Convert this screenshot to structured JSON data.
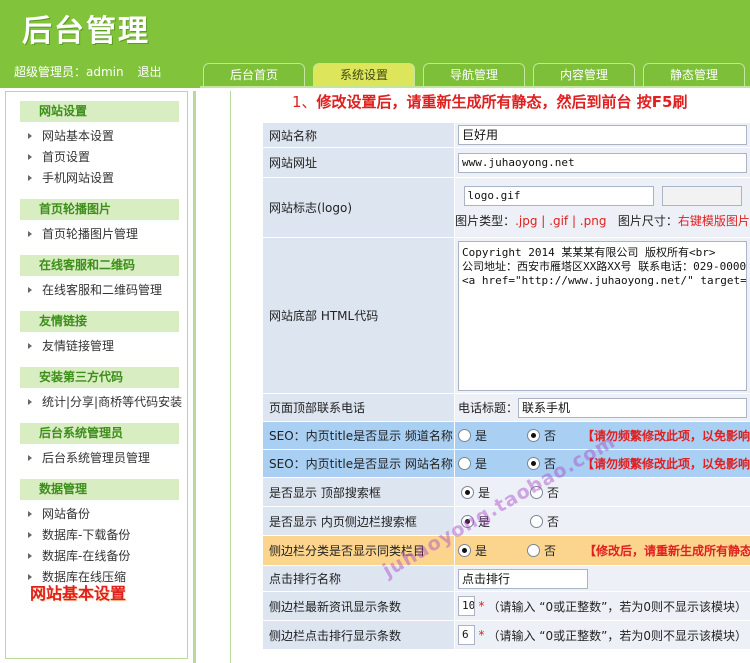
{
  "header": {
    "title": "后台管理",
    "user_label": "超级管理员：admin",
    "logout": "退出"
  },
  "tabs": [
    {
      "label": "后台首页"
    },
    {
      "label": "系统设置"
    },
    {
      "label": "导航管理"
    },
    {
      "label": "内容管理"
    },
    {
      "label": "静态管理"
    }
  ],
  "sidebar": {
    "sections": [
      {
        "title": "网站设置",
        "items": [
          "网站基本设置",
          "首页设置",
          "手机网站设置"
        ]
      },
      {
        "title": "首页轮播图片",
        "items": [
          "首页轮播图片管理"
        ]
      },
      {
        "title": "在线客服和二维码",
        "items": [
          "在线客服和二维码管理"
        ]
      },
      {
        "title": "友情链接",
        "items": [
          "友情链接管理"
        ]
      },
      {
        "title": "安装第三方代码",
        "items": [
          "统计|分享|商桥等代码安装"
        ]
      },
      {
        "title": "后台系统管理员",
        "items": [
          "后台系统管理员管理"
        ]
      },
      {
        "title": "数据管理",
        "items": [
          "网站备份",
          "数据库-下载备份",
          "数据库-在线备份",
          "数据库在线压缩"
        ]
      }
    ],
    "caption": "网站基本设置"
  },
  "notice": {
    "num": "1、",
    "text": "修改设置后，请重新生成所有静态，然后到前台 按F5刷"
  },
  "form": {
    "site_name_label": "网站名称",
    "site_name_value": "巨好用",
    "site_url_label": "网站网址",
    "site_url_value": "www.juhaoyong.net",
    "logo_label": "网站标志(logo)",
    "logo_value": "logo.gif",
    "logo_type_label": "图片类型：",
    "logo_type_value": ".jpg | .gif | .png",
    "logo_size_label": "图片尺寸：",
    "logo_size_value": "右键模版图片",
    "footer_label": "网站底部 HTML代码",
    "footer_value": "Copyright 2014 某某某有限公司 版权所有<br>\n公司地址：西安市雁塔区XX路XX号 联系电话：029-0000\n<a href=\"http://www.juhaoyong.net/\" target=\"_blan",
    "phone_label": "页面顶部联系电话",
    "phone_title_label": "电话标题：",
    "phone_title_value": "联系手机",
    "seo1_label": "SEO：内页title是否显示 频道名称",
    "seo2_label": "SEO：内页title是否显示 网站名称",
    "seo_warn": "【请勿频繁修改此项，以免影响搜",
    "top_search_label": "是否显示 顶部搜索框",
    "side_search_label": "是否显示 内页侧边栏搜索框",
    "side_cat_label": "侧边栏分类是否显示同类栏目",
    "side_cat_warn": "【修改后，请重新生成所有静态】",
    "yes": "是",
    "no": "否",
    "rank_name_label": "点击排行名称",
    "rank_name_value": "点击排行",
    "latest_count_label": "侧边栏最新资讯显示条数",
    "latest_count_value": "10",
    "rank_count_label": "侧边栏点击排行显示条数",
    "rank_count_value": "6",
    "star": "*",
    "count_hint": "（请输入 “0或正整数”，若为0则不显示该模块）"
  },
  "watermark": "juhaoyong.taobao.com"
}
